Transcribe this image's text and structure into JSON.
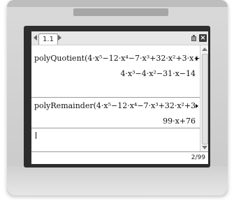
{
  "tab": {
    "label": "1.1"
  },
  "entries": [
    {
      "command": "polyQuotient(4·x⁵−12·x⁴−7·x³+32·x²+3·x+",
      "result": "4·x³−4·x²−31·x−14"
    },
    {
      "command": "polyRemainder(4·x⁵−12·x⁴−7·x³+32·x²+3·",
      "result": "99·x+76"
    }
  ],
  "status": {
    "page_count": "2/99"
  },
  "colors": {
    "bezel": "#2d2d2d",
    "tabbar": "#e7e7e7",
    "device": "#d0d0d0"
  }
}
